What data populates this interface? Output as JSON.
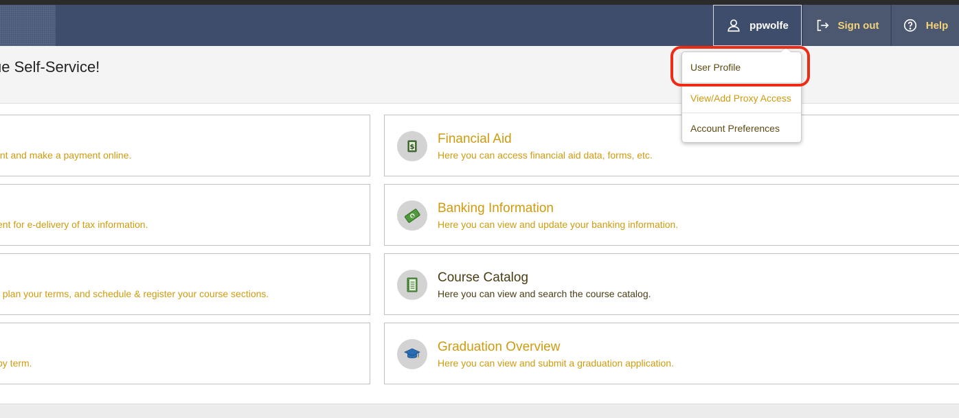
{
  "header": {
    "user_label": "ppwolfe",
    "signout_label": "Sign out",
    "help_label": "Help",
    "accent_color": "#f3d27a",
    "bar_color": "#3f4d6c"
  },
  "welcome": {
    "title": "ue Self-Service!"
  },
  "user_menu": {
    "items": [
      {
        "label": "User Profile"
      },
      {
        "label": "View/Add Proxy Access"
      },
      {
        "label": "Account Preferences"
      }
    ]
  },
  "tiles_left": [
    {
      "desc": "atement and make a payment online."
    },
    {
      "desc": "ent for e-delivery of tax information."
    },
    {
      "desc": ", plan your terms, and schedule & register your course sections."
    },
    {
      "desc": "by term."
    }
  ],
  "tiles_right": [
    {
      "icon": "dollar-document-icon",
      "title": "Financial Aid",
      "desc": "Here you can access financial aid data, forms, etc."
    },
    {
      "icon": "money-icon",
      "title": "Banking Information",
      "desc": "Here you can view and update your banking information."
    },
    {
      "icon": "notebook-icon",
      "title": "Course Catalog",
      "desc": "Here you can view and search the course catalog."
    },
    {
      "icon": "graduation-cap-icon",
      "title": "Graduation Overview",
      "desc": "Here you can view and submit a graduation application."
    }
  ]
}
